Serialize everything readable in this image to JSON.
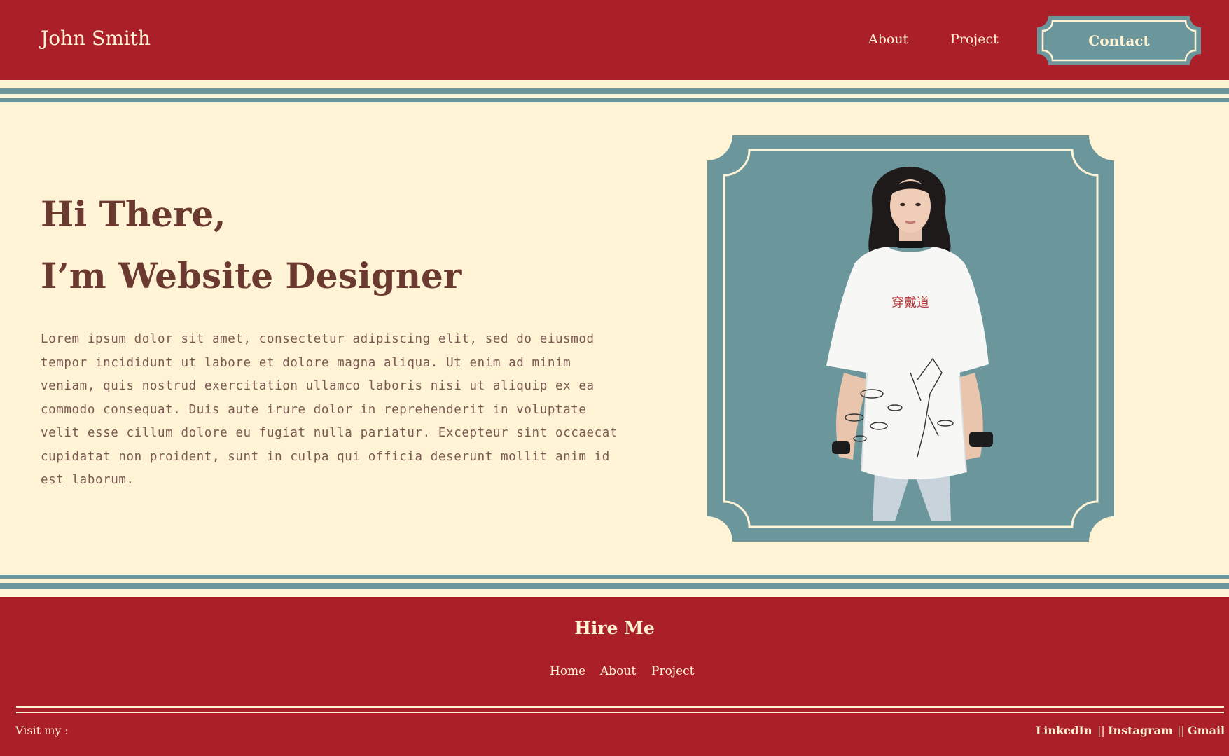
{
  "header": {
    "brand": "John Smith",
    "nav": {
      "about": "About",
      "project": "Project"
    },
    "contact_label": "Contact"
  },
  "hero": {
    "title_line1": "Hi There,",
    "title_line2": "I’m Website Designer",
    "body": "Lorem ipsum dolor sit amet, consectetur adipiscing elit, sed do eiusmod tempor incididunt ut labore et dolore magna aliqua. Ut enim ad minim veniam, quis nostrud exercitation ullamco laboris nisi ut aliquip ex ea commodo consequat. Duis aute irure dolor in reprehenderit in voluptate velit esse cillum dolore eu fugiat nulla pariatur. Excepteur sint occaecat cupidatat non proident, sunt in culpa qui officia deserunt mollit anim id est laborum.",
    "photo_icon": "portrait-photo"
  },
  "footer": {
    "hire": "Hire Me",
    "nav": {
      "home": "Home",
      "about": "About",
      "project": "Project"
    },
    "visit": "Visit my :",
    "separator": "||",
    "links": {
      "linkedin": "LinkedIn",
      "instagram": "Instagram",
      "gmail": "Gmail"
    }
  },
  "colors": {
    "red": "#ab1f29",
    "cream": "#fff3d6",
    "teal": "#6b969b",
    "brown": "#6a3a30"
  }
}
